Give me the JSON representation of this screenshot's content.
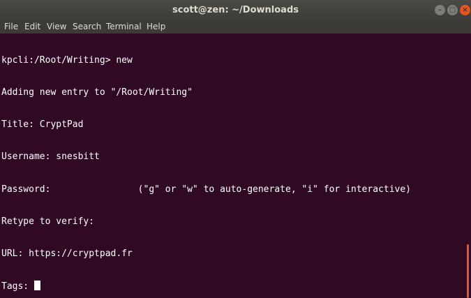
{
  "window": {
    "title": "scott@zen: ~/Downloads",
    "controls": {
      "minimize": "–",
      "maximize": "□",
      "close": "×"
    }
  },
  "menu": {
    "items": [
      "File",
      "Edit",
      "View",
      "Search",
      "Terminal",
      "Help"
    ]
  },
  "terminal": {
    "lines": [
      "kpcli:/Root/Writing> new",
      "Adding new entry to \"/Root/Writing\"",
      "Title: CryptPad",
      "Username: snesbitt",
      "Password:                (\"g\" or \"w\" to auto-generate, \"i\" for interactive)",
      "Retype to verify:",
      "URL: https://cryptpad.fr",
      "Tags: "
    ]
  },
  "colors": {
    "background": "#300a24",
    "foreground": "#ffffff",
    "accent": "#e95420"
  }
}
